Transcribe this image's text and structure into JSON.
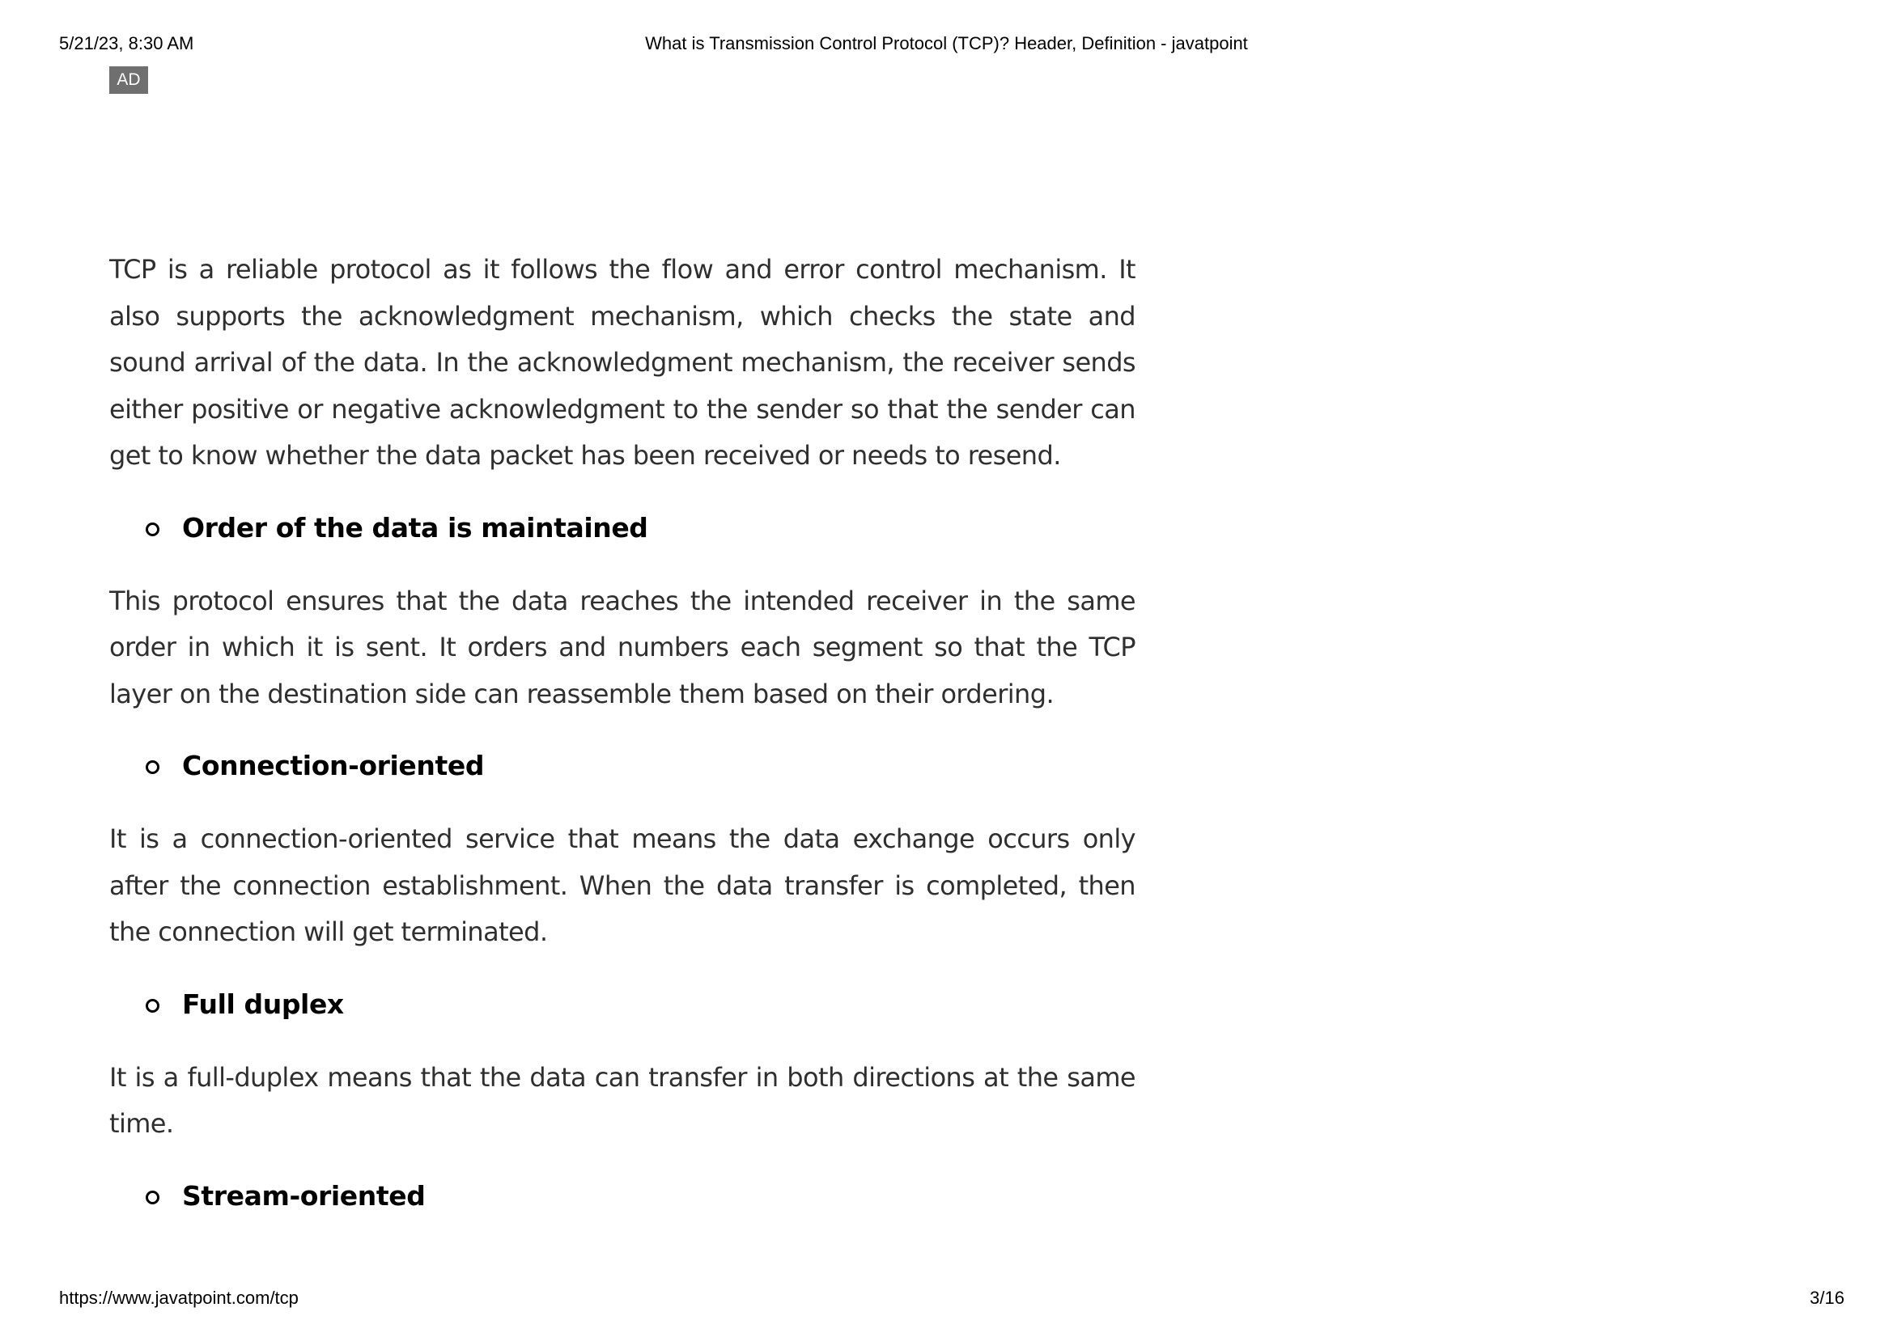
{
  "print_header": {
    "datetime": "5/21/23, 8:30 AM",
    "page_title": "What is Transmission Control Protocol (TCP)? Header, Definition - javatpoint"
  },
  "ad_badge": "AD",
  "article": {
    "blocks": [
      {
        "type": "paragraph",
        "text": "TCP is a reliable protocol as it follows the flow and error control mechanism. It also supports the acknowledgment mechanism, which checks the state and sound arrival of the data. In the acknowledgment mechanism, the receiver sends either positive or negative acknowledgment to the sender so that the sender can get to know whether the data packet has been received or needs to resend."
      },
      {
        "type": "heading",
        "text": "Order of the data is maintained"
      },
      {
        "type": "paragraph",
        "text": "This protocol ensures that the data reaches the intended receiver in the same order in which it is sent. It orders and numbers each segment so that the TCP layer on the destination side can reassemble them based on their ordering."
      },
      {
        "type": "heading",
        "text": "Connection-oriented"
      },
      {
        "type": "paragraph",
        "text": "It is a connection-oriented service that means the data exchange occurs only after the connection establishment. When the data transfer is completed, then the connection will get terminated."
      },
      {
        "type": "heading",
        "text": "Full duplex"
      },
      {
        "type": "paragraph",
        "text": "It is a full-duplex means that the data can transfer in both directions at the same time."
      },
      {
        "type": "heading",
        "text": "Stream-oriented"
      }
    ]
  },
  "print_footer": {
    "url": "https://www.javatpoint.com/tcp",
    "page_number": "3/16"
  }
}
